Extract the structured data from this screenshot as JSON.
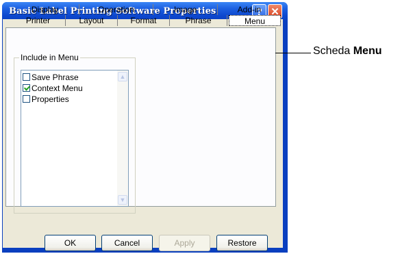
{
  "window": {
    "title": "Basic Label Printing Software Properties"
  },
  "titlebar": {
    "help_glyph": "?",
    "close_glyph": "✕"
  },
  "tabs": {
    "row1": [
      "Display",
      "Operation",
      "Image",
      "Add-in"
    ],
    "row2": [
      "Printer",
      "Layout",
      "Format",
      "Phrase",
      "Menu"
    ],
    "active": "Menu"
  },
  "group": {
    "label": "Include in Menu",
    "items": [
      {
        "label": "Save Phrase",
        "checked": false
      },
      {
        "label": "Context Menu",
        "checked": true
      },
      {
        "label": "Properties",
        "checked": false
      }
    ]
  },
  "buttons": {
    "ok": "OK",
    "cancel": "Cancel",
    "apply": "Apply",
    "restore": "Restore"
  },
  "callout": {
    "prefix": "Scheda ",
    "bold": "Menu"
  }
}
